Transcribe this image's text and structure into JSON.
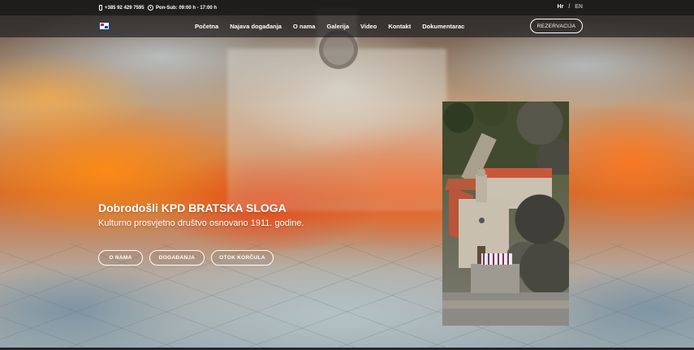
{
  "topbar": {
    "phone": "+385 92 429 7595",
    "hours": "Pon-Sub: 09:00 h - 17:00 h",
    "lang_active": "Hr",
    "lang_sep": "/",
    "lang_other": "EN"
  },
  "nav": {
    "items": [
      {
        "label": "Početna"
      },
      {
        "label": "Najava događanja"
      },
      {
        "label": "O nama"
      },
      {
        "label": "Galerija"
      },
      {
        "label": "Video"
      },
      {
        "label": "Kontakt"
      },
      {
        "label": "Dokumentarac"
      }
    ],
    "reservation": "REZERVACIJA"
  },
  "hero": {
    "title": "Dobrodošli  KPD BRATSKA SLOGA",
    "subtitle": "Kulturno prosvjetno društvo osnovano 1911. godine.",
    "buttons": [
      {
        "label": "O NAMA"
      },
      {
        "label": "DOGAĐANJA"
      },
      {
        "label": "OTOK KORČULA"
      }
    ]
  }
}
